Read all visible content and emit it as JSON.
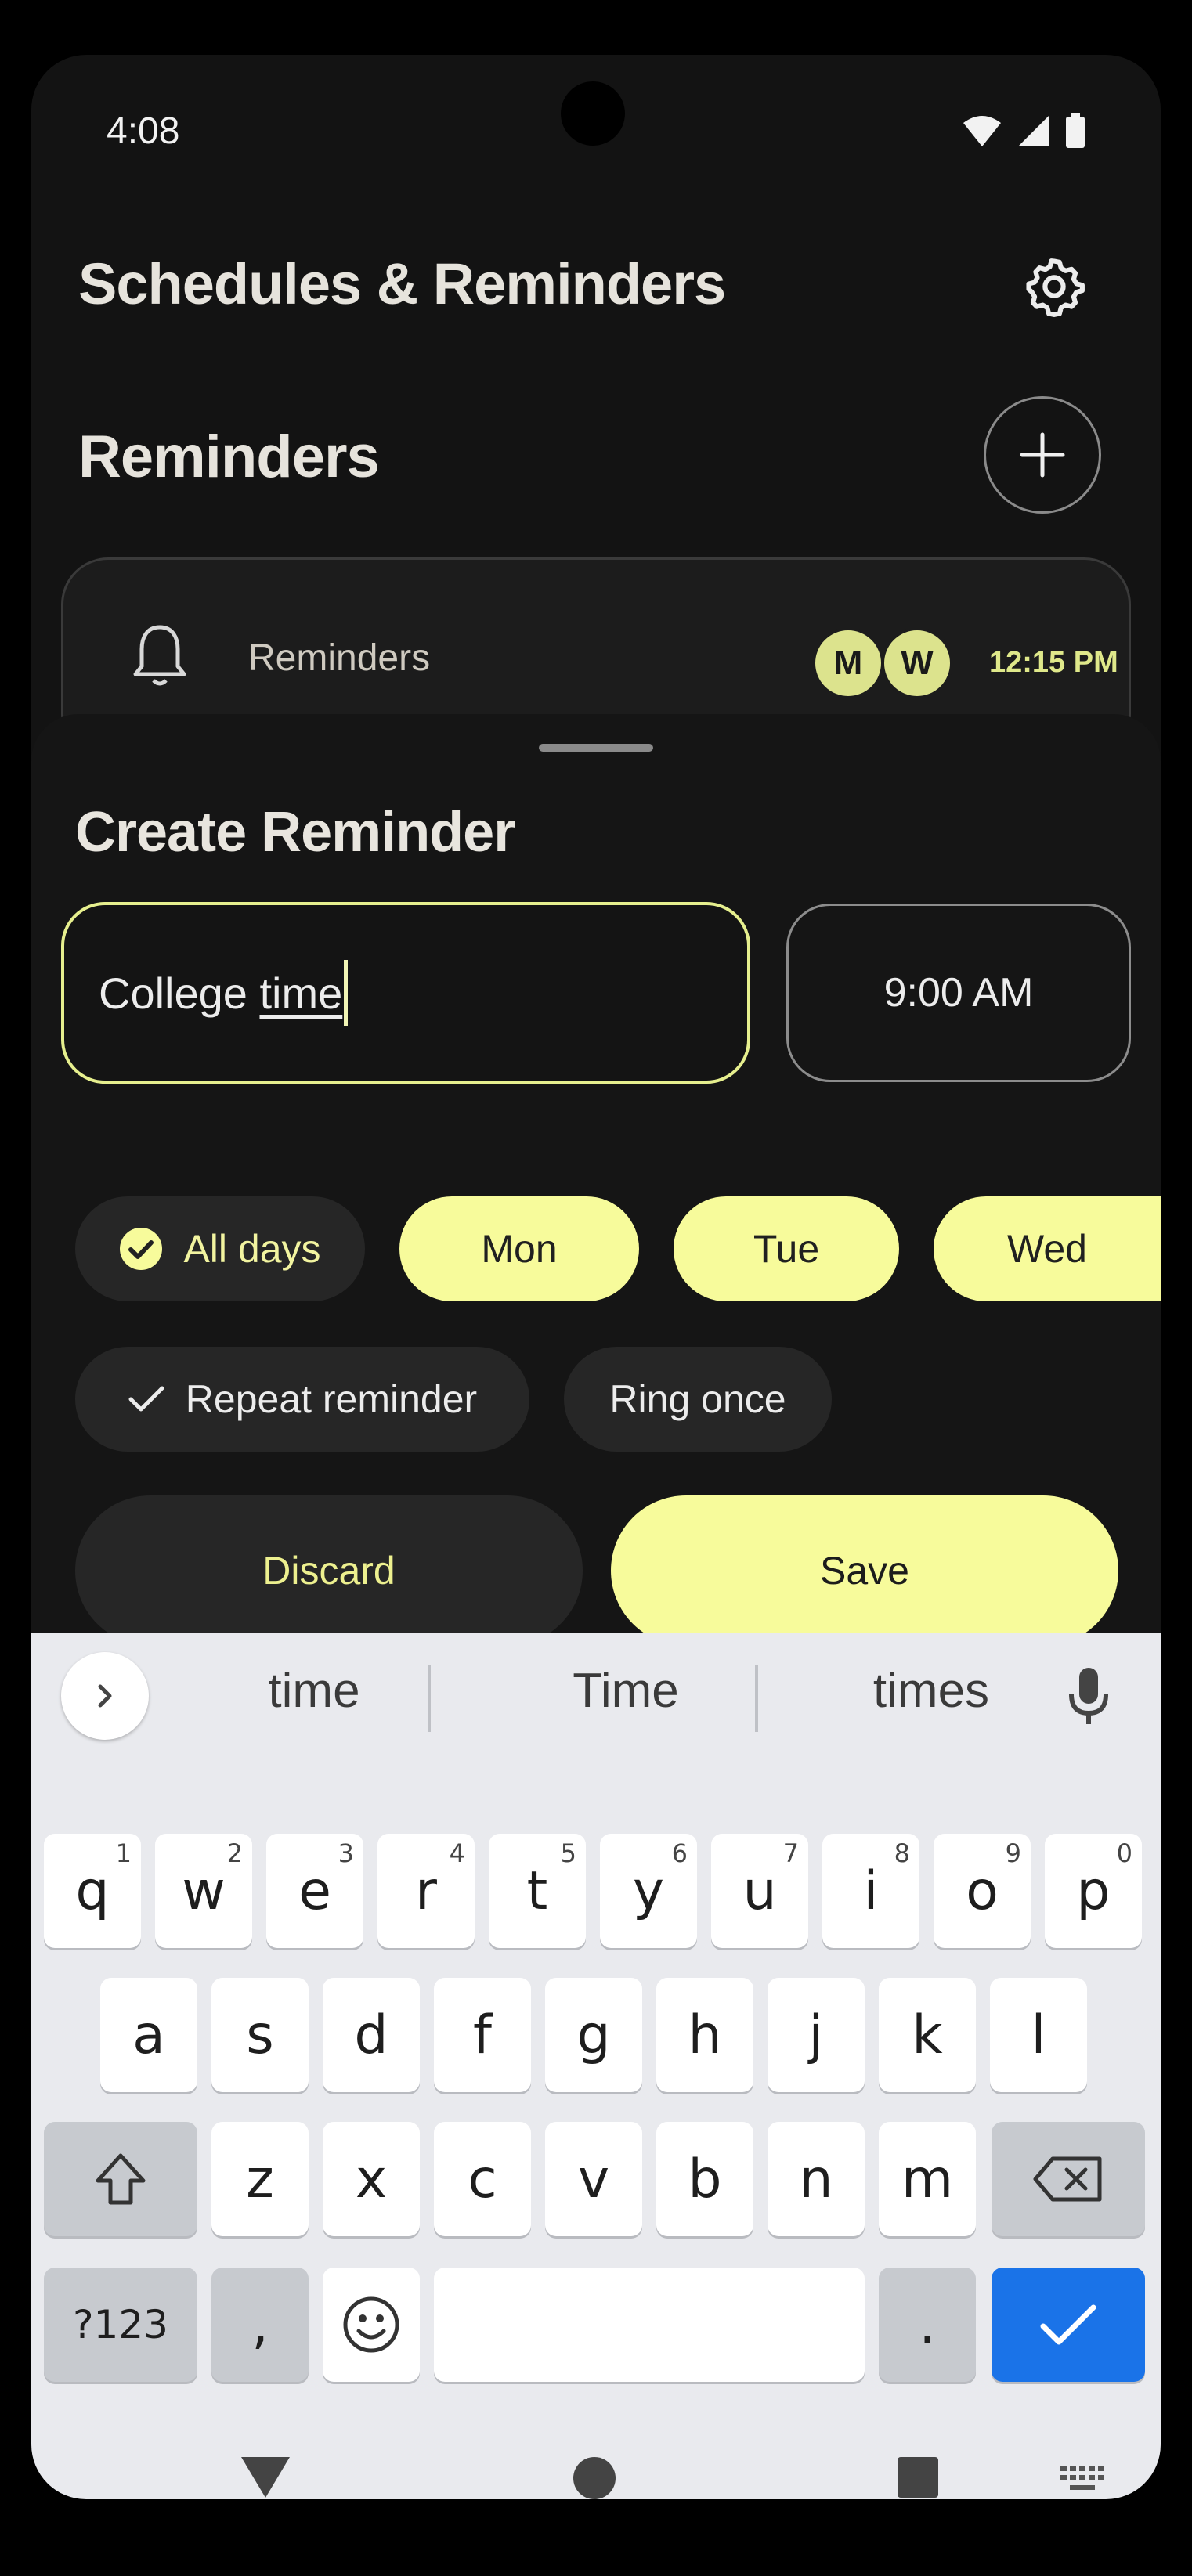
{
  "status": {
    "time": "4:08"
  },
  "app": {
    "title": "Schedules & Reminders"
  },
  "reminders_section": {
    "title": "Reminders"
  },
  "reminder_card": {
    "label": "Reminders",
    "days": [
      "M",
      "W"
    ],
    "time": "12:15 PM"
  },
  "sheet": {
    "title": "Create Reminder",
    "name_value_plain": "College ",
    "name_value_underlined": "time",
    "time_value": "9:00 AM",
    "days": {
      "all_label": "All days",
      "chips": [
        "Mon",
        "Tue",
        "Wed"
      ]
    },
    "repeat_label": "Repeat reminder",
    "ring_once_label": "Ring once",
    "discard_label": "Discard",
    "save_label": "Save"
  },
  "keyboard": {
    "suggestions": [
      "time",
      "Time",
      "times"
    ],
    "row1": [
      {
        "k": "q",
        "n": "1"
      },
      {
        "k": "w",
        "n": "2"
      },
      {
        "k": "e",
        "n": "3"
      },
      {
        "k": "r",
        "n": "4"
      },
      {
        "k": "t",
        "n": "5"
      },
      {
        "k": "y",
        "n": "6"
      },
      {
        "k": "u",
        "n": "7"
      },
      {
        "k": "i",
        "n": "8"
      },
      {
        "k": "o",
        "n": "9"
      },
      {
        "k": "p",
        "n": "0"
      }
    ],
    "row2": [
      "a",
      "s",
      "d",
      "f",
      "g",
      "h",
      "j",
      "k",
      "l"
    ],
    "row3": [
      "z",
      "x",
      "c",
      "v",
      "b",
      "n",
      "m"
    ],
    "symbols_label": "?123",
    "comma": ",",
    "period": "."
  },
  "colors": {
    "accent": "#f7fb9b",
    "background": "#131313",
    "keyboard_blue": "#1a73e8"
  }
}
